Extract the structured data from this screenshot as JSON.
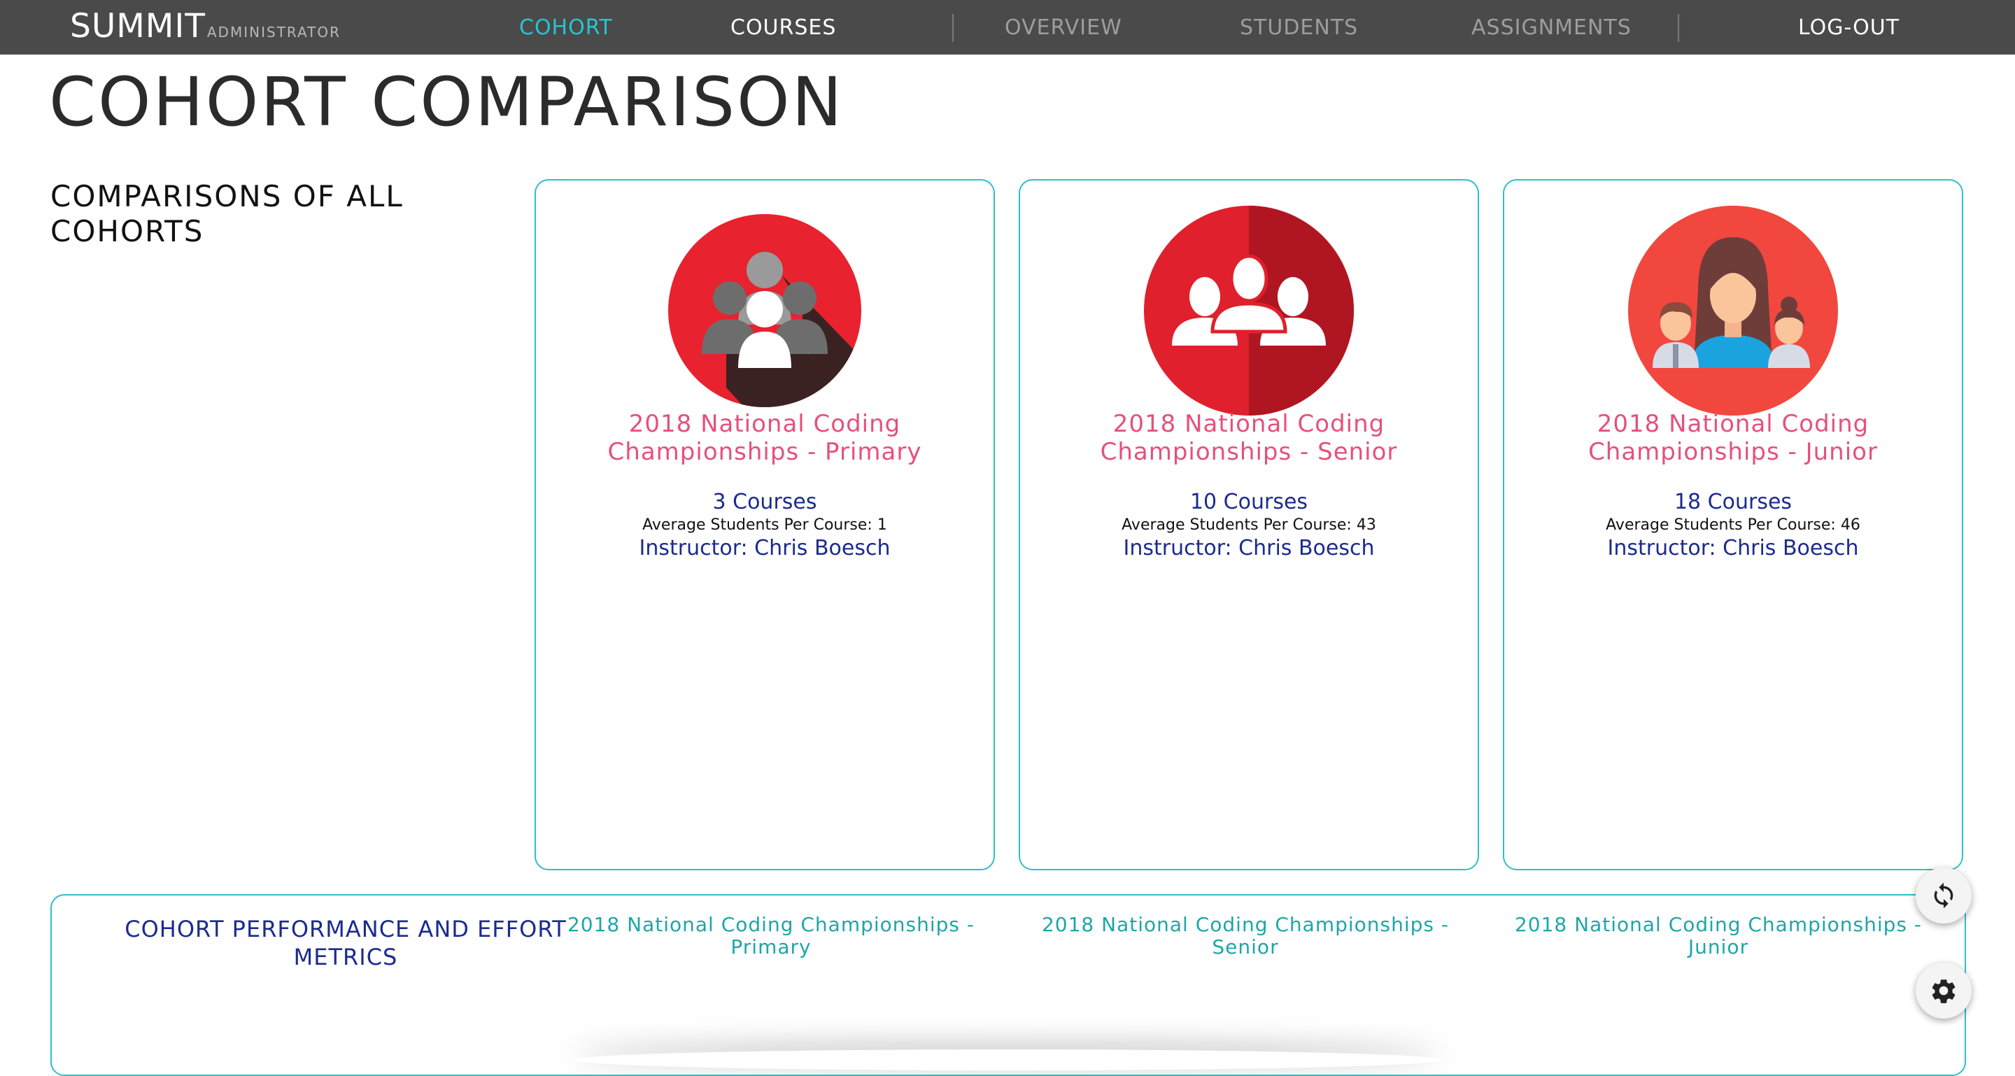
{
  "app": {
    "brand": "SUMMIT",
    "brand_sub": "ADMINISTRATOR"
  },
  "nav": {
    "cohort": "COHORT",
    "courses": "COURSES",
    "overview": "OVERVIEW",
    "students": "STUDENTS",
    "assignments": "ASSIGNMENTS",
    "logout": "LOG-OUT"
  },
  "page": {
    "title": "COHORT COMPARISON",
    "section_title": "COMPARISONS OF ALL COHORTS"
  },
  "cohorts": [
    {
      "name": "2018 National Coding Championships - Primary",
      "courses": "3 Courses",
      "avg_students": "Average Students Per Course: 1",
      "instructor": "Instructor: Chris Boesch",
      "icon": "group-silhouette-icon"
    },
    {
      "name": "2018 National Coding Championships - Senior",
      "courses": "10 Courses",
      "avg_students": "Average Students Per Course: 43",
      "instructor": "Instructor: Chris Boesch",
      "icon": "team-outline-icon"
    },
    {
      "name": "2018 National Coding Championships - Junior",
      "courses": "18 Courses",
      "avg_students": "Average Students Per Course: 46",
      "instructor": "Instructor: Chris Boesch",
      "icon": "family-avatar-icon"
    }
  ],
  "metrics": {
    "title": "COHORT PERFORMANCE AND EFFORT METRICS",
    "columns": [
      "2018 National Coding Championships - Primary",
      "2018 National Coding Championships - Senior",
      "2018 National Coding Championships - Junior"
    ]
  },
  "colors": {
    "accent": "#26c6cf",
    "cohort_name": "#e5517b",
    "navy": "#1b2b8f",
    "topbar": "#4a4a4a"
  },
  "fabs": {
    "refresh_icon": "refresh-icon",
    "settings_icon": "gear-icon"
  }
}
